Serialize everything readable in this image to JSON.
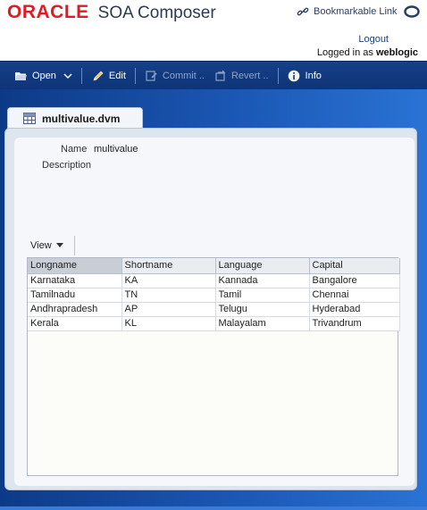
{
  "header": {
    "brand": "ORACLE",
    "app_name": "SOA Composer",
    "bookmark_label": "Bookmarkable Link",
    "logout_label": "Logout",
    "logged_in_prefix": "Logged in as",
    "username": "weblogic"
  },
  "toolbar": {
    "open_label": "Open",
    "edit_label": "Edit",
    "commit_label": "Commit ..",
    "revert_label": "Revert ..",
    "info_label": "Info"
  },
  "tab": {
    "label": "multivalue.dvm"
  },
  "details": {
    "name_label": "Name",
    "name_value": "multivalue",
    "description_label": "Description"
  },
  "table": {
    "view_label": "View",
    "columns": [
      "Longname",
      "Shortname",
      "Language",
      "Capital"
    ],
    "rows": [
      [
        "Karnataka",
        "KA",
        "Kannada",
        "Bangalore"
      ],
      [
        "Tamilnadu",
        "TN",
        "Tamil",
        "Chennai"
      ],
      [
        "Andhrapradesh",
        "AP",
        "Telugu",
        "Hyderabad"
      ],
      [
        "Kerala",
        "KL",
        "Malayalam",
        "Trivandrum"
      ]
    ]
  },
  "colors": {
    "brand_red": "#e01b22",
    "toolbar_blue": "#163f86",
    "main_blue": "#1b57b4"
  }
}
